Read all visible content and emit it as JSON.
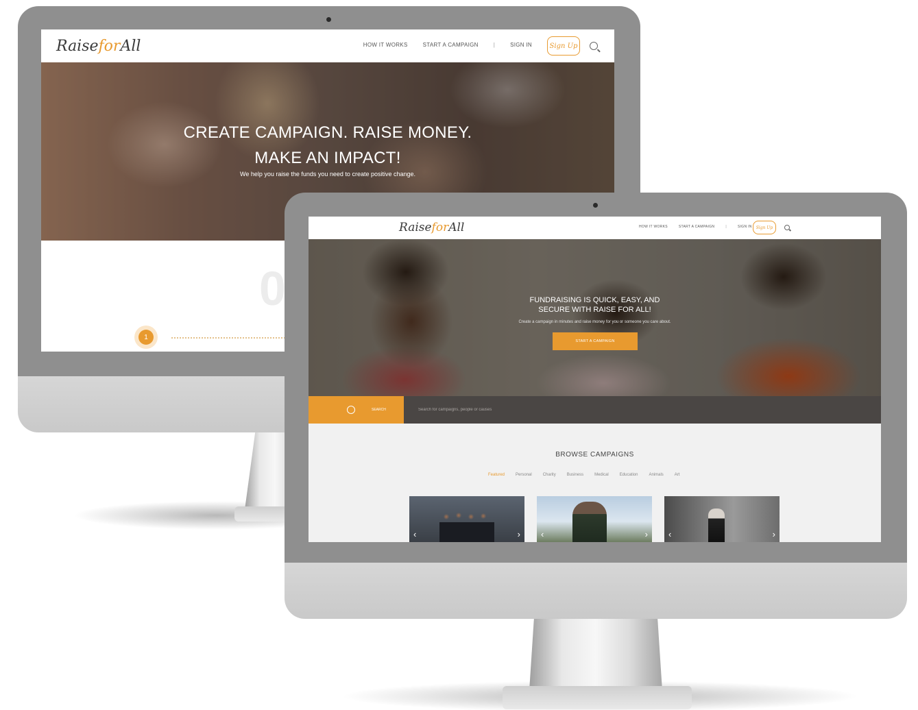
{
  "brand": {
    "logo_raise": "Raise",
    "logo_for": "for",
    "logo_all": "All",
    "accent_color": "#e89a2f"
  },
  "back_site": {
    "nav": {
      "how_it_works": "HOW IT WORKS",
      "start_campaign": "START A CAMPAIGN",
      "separator": "|",
      "sign_in": "SIGN IN",
      "sign_up": "Sign Up",
      "search_icon": "search-icon"
    },
    "hero": {
      "title_line1": "CREATE CAMPAIGN. RAISE MONEY.",
      "title_line2": "MAKE AN IMPACT!",
      "subtitle": "We help you raise the funds you need to create positive change."
    },
    "steps": {
      "big_number": "0",
      "step1_number": "1"
    }
  },
  "front_site": {
    "nav": {
      "how_it_works": "HOW IT WORKS",
      "start_campaign": "START A CAMPAIGN",
      "separator": "|",
      "sign_in": "SIGN IN",
      "sign_up": "Sign Up",
      "search_icon": "search-icon"
    },
    "hero": {
      "title_line1": "FUNDRAISING IS QUICK, EASY, AND",
      "title_line2": "SECURE WITH RAISE FOR ALL!",
      "subtitle": "Create a campaign in minutes and raise money for you or someone you care about.",
      "cta": "START A CAMPAIGN"
    },
    "search": {
      "label": "SEARCH",
      "placeholder": "Search for campaigns, people or causes"
    },
    "browse": {
      "title": "BROWSE CAMPAIGNS",
      "categories": [
        "Featured",
        "Personal",
        "Charity",
        "Business",
        "Medical",
        "Education",
        "Animals",
        "Art"
      ],
      "active_category": "Featured"
    },
    "cards": {
      "prev_arrow": "‹",
      "next_arrow": "›"
    }
  }
}
